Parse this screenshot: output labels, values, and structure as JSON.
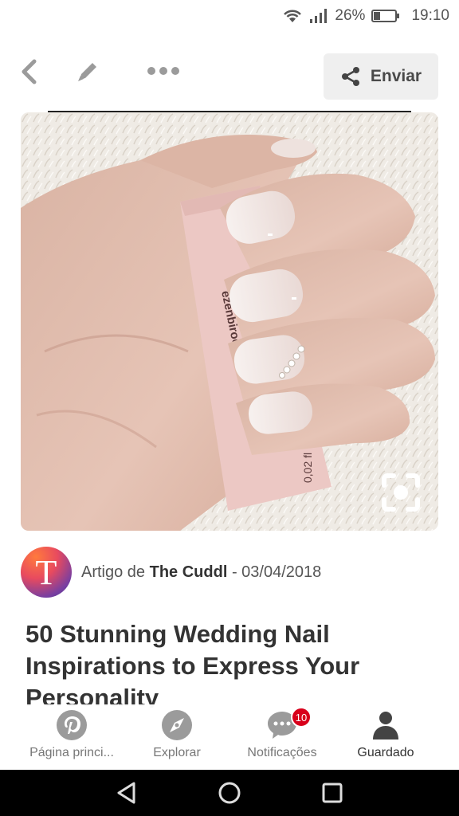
{
  "status_bar": {
    "battery": "26%",
    "time": "19:10",
    "icons": [
      "wifi-icon",
      "signal-icon",
      "battery-icon"
    ]
  },
  "toolbar": {
    "back_icon": "chevron-left-icon",
    "edit_icon": "pencil-icon",
    "more_icon": "more-dots-icon",
    "send_label": "Enviar"
  },
  "pin": {
    "image_alt": "hand with ombre nude nails and rhinestones",
    "box_text_1": "ezenbirod",
    "box_text_2": "0,02 fl"
  },
  "author": {
    "initial": "T",
    "prefix": "Artigo de",
    "name": "The Cuddl",
    "date": "- 03/04/2018"
  },
  "article": {
    "title": "50 Stunning Wedding Nail Inspirations to Express Your Personality"
  },
  "bottom_nav": {
    "items": [
      {
        "label": "Página princi...",
        "icon": "pinterest-icon"
      },
      {
        "label": "Explorar",
        "icon": "compass-icon"
      },
      {
        "label": "Notificações",
        "icon": "chat-bubble-icon",
        "badge": "10"
      },
      {
        "label": "Guardado",
        "icon": "user-icon"
      }
    ]
  },
  "colors": {
    "badge": "#d8001b",
    "icon_gray": "#9b9b9b",
    "text_dark": "#333333"
  }
}
